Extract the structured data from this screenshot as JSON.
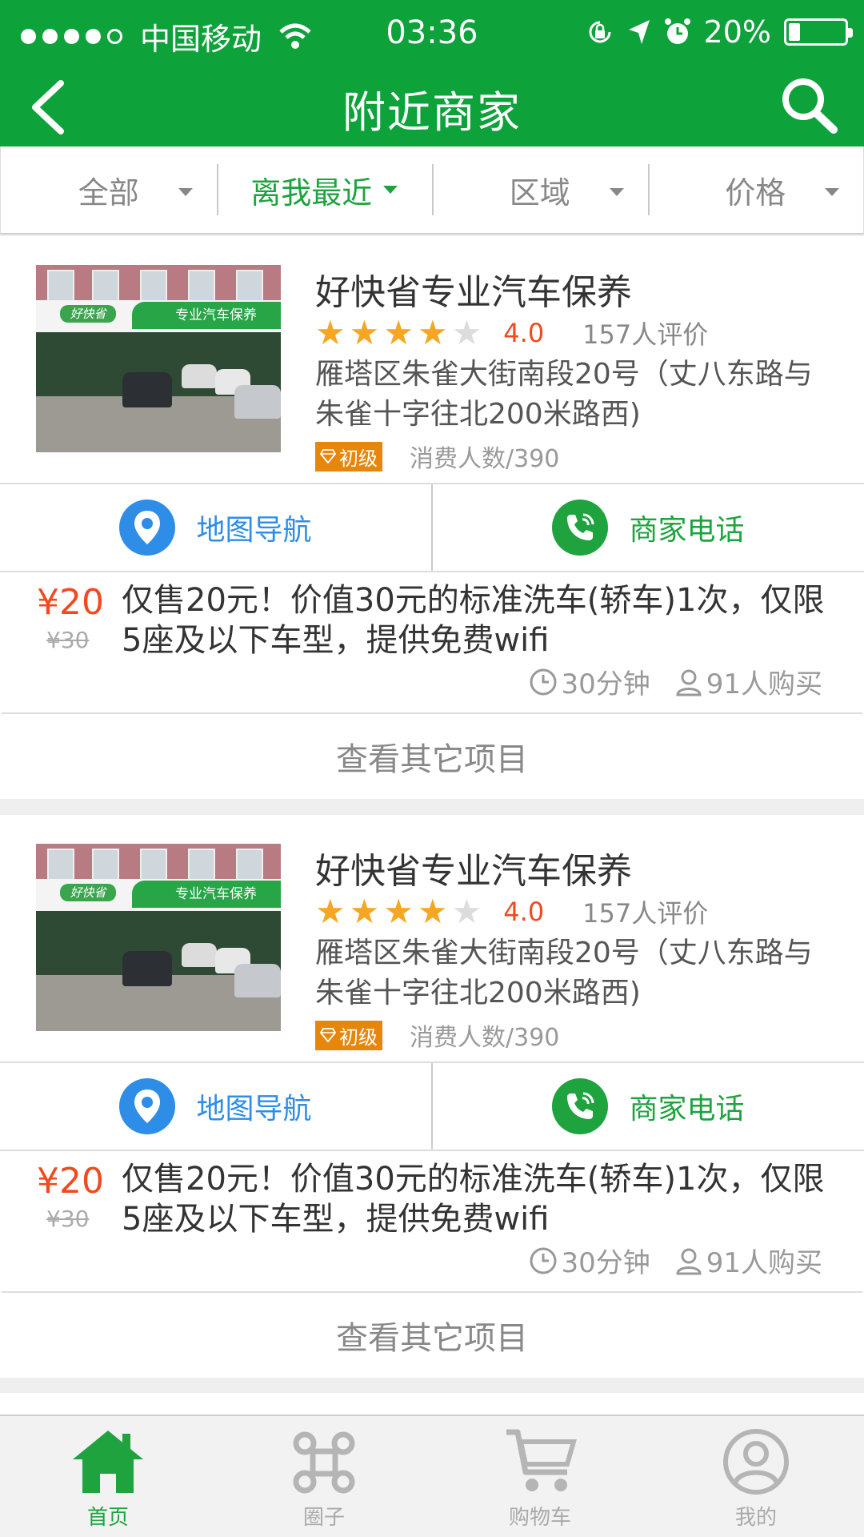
{
  "status_bar": {
    "carrier": "中国移动",
    "time": "03:36",
    "battery": "20%",
    "battery_level": 0.2,
    "signal_dots_filled": 4,
    "signal_dots_total": 5
  },
  "header": {
    "title": "附近商家",
    "background_color": "#0ea23b"
  },
  "filters": [
    {
      "label": "全部",
      "active": false
    },
    {
      "label": "离我最近",
      "active": true
    },
    {
      "label": "区域",
      "active": false
    },
    {
      "label": "价格",
      "active": false
    }
  ],
  "merchants": [
    {
      "name": "好快省专业汽车保养",
      "rating": 4,
      "score": "4.0",
      "reviews": "157人评价",
      "address": "雁塔区朱雀大街南段20号（丈八东路与朱雀十字往北200米路西)",
      "level": "初级",
      "consumers": "消费人数/390",
      "sign_text": "专业汽车保养",
      "logo_text": "好快省",
      "map_label": "地图导航",
      "phone_label": "商家电话",
      "deal": {
        "price": "¥20",
        "original_price": "¥30",
        "description": "仅售20元！价值30元的标准洗车(轿车)1次，仅限5座及以下车型，提供免费wifi",
        "duration": "30分钟",
        "buyers": "91人购买"
      },
      "more_label": "查看其它项目"
    },
    {
      "name": "好快省专业汽车保养",
      "rating": 4,
      "score": "4.0",
      "reviews": "157人评价",
      "address": "雁塔区朱雀大街南段20号（丈八东路与朱雀十字往北200米路西)",
      "level": "初级",
      "consumers": "消费人数/390",
      "sign_text": "专业汽车保养",
      "logo_text": "好快省",
      "map_label": "地图导航",
      "phone_label": "商家电话",
      "deal": {
        "price": "¥20",
        "original_price": "¥30",
        "description": "仅售20元！价值30元的标准洗车(轿车)1次，仅限5座及以下车型，提供免费wifi",
        "duration": "30分钟",
        "buyers": "91人购买"
      },
      "more_label": "查看其它项目"
    }
  ],
  "tabbar": [
    {
      "label": "首页",
      "icon": "home-icon",
      "active": true
    },
    {
      "label": "圈子",
      "icon": "command-icon",
      "active": false
    },
    {
      "label": "购物车",
      "icon": "cart-icon",
      "active": false
    },
    {
      "label": "我的",
      "icon": "profile-icon",
      "active": false
    }
  ],
  "colors": {
    "accent_green": "#1ea33f",
    "map_blue": "#2e8de6",
    "price_red": "#f04a1e",
    "star_orange": "#f5a623",
    "badge_orange": "#e6870c"
  }
}
